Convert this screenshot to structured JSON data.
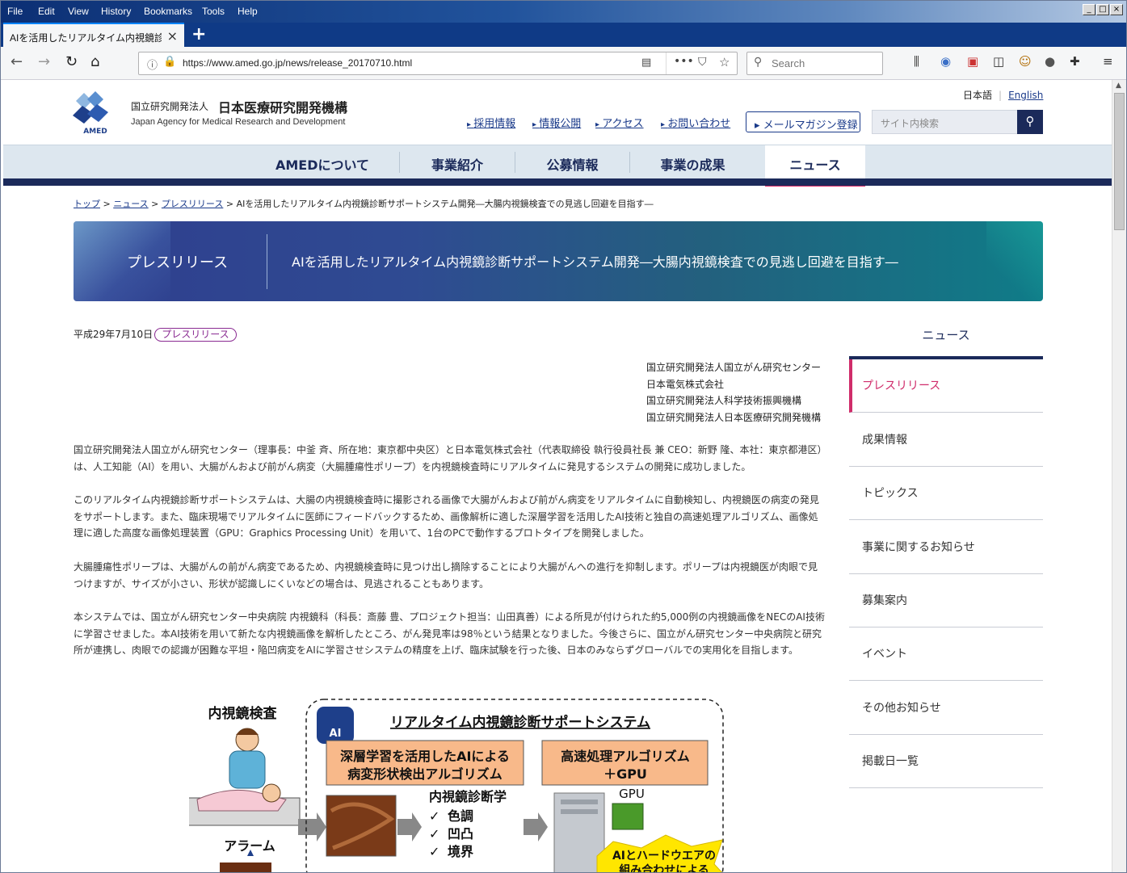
{
  "browser": {
    "menu": [
      "File",
      "Edit",
      "View",
      "History",
      "Bookmarks",
      "Tools",
      "Help"
    ],
    "tab_title": "AIを活用したリアルタイム内視鏡診断サ",
    "url": "https://www.amed.go.jp/news/release_20170710.html",
    "search_placeholder": "Search"
  },
  "site": {
    "org_small": "国立研究開発法人",
    "org_name": "日本医療研究開発機構",
    "org_en": "Japan Agency for Medical Research and Development",
    "logo_text": "AMED",
    "lang_ja": "日本語",
    "lang_en": "English",
    "util_links": [
      "採用情報",
      "情報公開",
      "アクセス",
      "お問い合わせ"
    ],
    "mailmag": "メールマガジン登録",
    "search_placeholder": "サイト内検索",
    "gnav": [
      "AMEDについて",
      "事業紹介",
      "公募情報",
      "事業の成果",
      "ニュース"
    ],
    "active_nav": "ニュース"
  },
  "breadcrumb": {
    "items": [
      "トップ",
      "ニュース",
      "プレスリリース"
    ],
    "current": "AIを活用したリアルタイム内視鏡診断サポートシステム開発―大腸内視鏡検査での見逃し回避を目指す―"
  },
  "banner": {
    "section": "プレスリリース",
    "title": "AIを活用したリアルタイム内視鏡診断サポートシステム開発―大腸内視鏡検査での見逃し回避を目指す―"
  },
  "article": {
    "date": "平成29年7月10日",
    "badge": "プレスリリース",
    "orgs": [
      "国立研究開発法人国立がん研究センター",
      "日本電気株式会社",
      "国立研究開発法人科学技術振興機構",
      "国立研究開発法人日本医療研究開発機構"
    ],
    "paragraphs": [
      "国立研究開発法人国立がん研究センター（理事長：中釜 斉、所在地：東京都中央区）と日本電気株式会社（代表取締役 執行役員社長 兼 CEO：新野 隆、本社：東京都港区）は、人工知能（AI）を用い、大腸がんおよび前がん病変（大腸腫瘍性ポリープ）を内視鏡検査時にリアルタイムに発見するシステムの開発に成功しました。",
      "このリアルタイム内視鏡診断サポートシステムは、大腸の内視鏡検査時に撮影される画像で大腸がんおよび前がん病変をリアルタイムに自動検知し、内視鏡医の病変の発見をサポートします。また、臨床現場でリアルタイムに医師にフィードバックするため、画像解析に適した深層学習を活用したAI技術と独自の高速処理アルゴリズム、画像処理に適した高度な画像処理装置（GPU：Graphics Processing Unit）を用いて、1台のPCで動作するプロトタイプを開発しました。",
      "大腸腫瘍性ポリープは、大腸がんの前がん病変であるため、内視鏡検査時に見つけ出し摘除することにより大腸がんへの進行を抑制します。ポリープは内視鏡医が肉眼で見つけますが、サイズが小さい、形状が認識しにくいなどの場合は、見逃されることもあります。",
      "本システムでは、国立がん研究センター中央病院 内視鏡科（科長：斎藤 豊、プロジェクト担当：山田真善）による所見が付けられた約5,000例の内視鏡画像をNECのAI技術に学習させました。本AI技術を用いて新たな内視鏡画像を解析したところ、がん発見率は98％という結果となりました。今後さらに、国立がん研究センター中央病院と研究所が連携し、肉眼での認識が困難な平坦・陥凹病変をAIに学習させシステムの精度を上げ、臨床試験を行った後、日本のみならずグローバルでの実用化を目指します。"
    ]
  },
  "figure": {
    "left_title": "内視鏡検査",
    "alarm": "アラーム",
    "ai_label": "AI",
    "system_title": "リアルタイム内視鏡診断サポートシステム",
    "box1_line1": "深層学習を活用したAIによる",
    "box1_line2": "病変形状検出アルゴリズム",
    "box2_line1": "高速処理アルゴリズム",
    "box2_line2": "＋GPU",
    "diag_title": "内視鏡診断学",
    "diag_items": [
      "色調",
      "凹凸",
      "境界"
    ],
    "gpu_label": "GPU",
    "burst_line1": "AIとハードウエアの",
    "burst_line2": "組み合わせによる"
  },
  "sidebar": {
    "title": "ニュース",
    "items": [
      "プレスリリース",
      "成果情報",
      "トピックス",
      "事業に関するお知らせ",
      "募集案内",
      "イベント",
      "その他お知らせ",
      "掲載日一覧"
    ]
  },
  "colors": {
    "navy": "#1b2a5a",
    "accent": "#e0306a",
    "badge": "#8a2b92",
    "link": "#1a3a8a"
  }
}
